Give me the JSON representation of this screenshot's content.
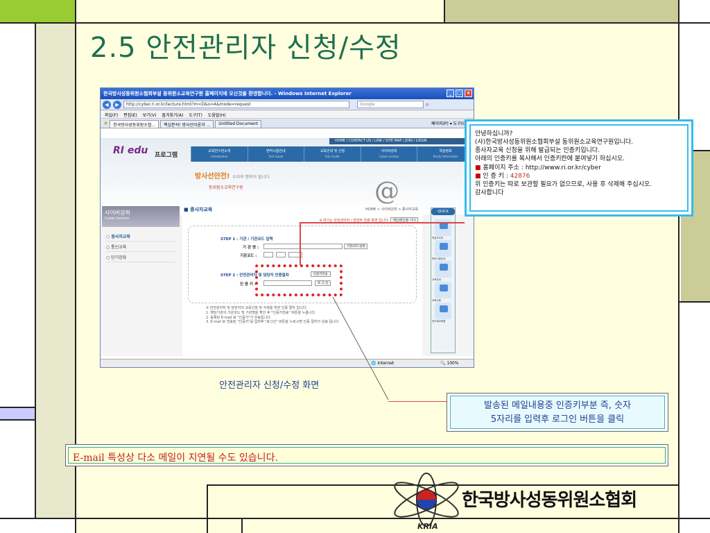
{
  "slide": {
    "title": "2.5 안전관리자 신청/수정",
    "caption": "안전관리자 신청/수정 화면",
    "action_note_line1": "발송된 메일내용중 인증키부분 즉, 숫자",
    "action_note_line2": "5자리를 입력후  로그인 버튼을 클릭",
    "email_warning": "E-mail 특성상 다소 메일이 지연될 수도 있습니다.",
    "org_name": "한국방사성동위원소협회",
    "org_abbr": "KRIA"
  },
  "browser": {
    "window_title": "한국방사성동위원소협회부설 동위원소교육연구원 홈페이지에 오신것을 환영합니다. - Windows Internet Explorer",
    "address": "http://cyber.ri.or.kr/lecture.html?m=D&s=A&mode=request",
    "search_placeholder": "Google",
    "menu": [
      "파일(F)",
      "편집(E)",
      "보기(V)",
      "즐겨찾기(A)",
      "도구(T)",
      "도움말(H)"
    ],
    "tabs": [
      "한국방사성동위원소협...",
      "핵심분석! 방사선이론과 ...",
      "Untitled Document"
    ],
    "tools": "페이지(P) ▾  도구(O) ▾",
    "status_zone": "Internet",
    "status_zoom": "100%"
  },
  "site": {
    "util_links": "HOME / CONTACT US / LINK / SITE MAP / JOIN / LOGIN",
    "logo": "RI edu",
    "logo_suffix": "프로그램",
    "gnb": [
      {
        "label": "교육연구원소개",
        "sub": "Introduction"
      },
      {
        "label": "면허시험안내",
        "sub": "Test Guide"
      },
      {
        "label": "교육안내 및 신청",
        "sub": "Edu Guide"
      },
      {
        "label": "사이버강좌",
        "sub": "Cyber Lecture"
      },
      {
        "label": "학습정보",
        "sub": "Study Information"
      }
    ],
    "slogan": "방사선안전!",
    "slogan_sub": "우리의 행복이 됩니다",
    "org_line": "동위원소교육연구원",
    "side_banner": "사이버강좌",
    "side_banner_sub": "Cyber Lecture",
    "side_menu": [
      "종사자교육",
      "통신교육",
      "단기강좌"
    ],
    "content_title": "종사자교육",
    "breadcrumb": "HOME > 사이버강좌 > 종사자교육",
    "notice": "※ 여기는 안전관리자 / 담당자 전용 화면 입니다.",
    "notice_button": "개인맨신청 가기",
    "step1": "STEP 1 : 기관 / 기관코드 입력",
    "org_name_label": "기 관 명 :",
    "org_search_btn": "기관/코드검색",
    "org_code_label": "기관코드 :",
    "step2": "STEP 2 : 안전관리자 및 담당자 인증절차",
    "auth_send_btn": "인증키전송",
    "auth_key_label": "인 증 키 :",
    "login_btn": "로 그 인",
    "instructions": [
      "※ 안전관리자 및 담당자의 교육신청 및 수정을 위한 인증 절차 입니다.",
      "1. 해당기관의 기관코드 및 기관명을 확인 후 \"인증키전송\" 버튼을 누릅니다.",
      "2. 등록된 E-mail 로 \"인증키\"가 전송됩니다.",
      "3. E-mail 로 전송된 \"인증키\"를 입력후 \"로그인\" 버튼을 누르시면 인증 절차가 완료 됩니다"
    ],
    "quick_title": "QUICK",
    "quick_items": [
      "학습도우미",
      "면허시험안내",
      "교육안내",
      "교육신청",
      "반도체교육원"
    ]
  },
  "email": {
    "lines": [
      "안녕하십니까?",
      "(사)한국방사성동위원소협회부설 동위원소교육연구원입니다.",
      "종사자교육 신청을 위해 발급되는 인증키입니다.",
      "아래의 인증키를 복사해서 인증키란에 붙여넣기 하십시오."
    ],
    "homepage_label": "홈페이지 주소 : ",
    "homepage_url": "http://www.ri.or.kr/cyber",
    "key_label": "인 증 키 : ",
    "key_value": "42876",
    "tail_lines": [
      "위 인증키는 따로 보관할 필요가 없으므로, 사용 후 삭제해 주십시오.",
      "감사합니다"
    ]
  },
  "colors": {
    "title": "#1f6f4f",
    "highlight_red": "#dd2222",
    "callout_border": "#33bbee"
  }
}
